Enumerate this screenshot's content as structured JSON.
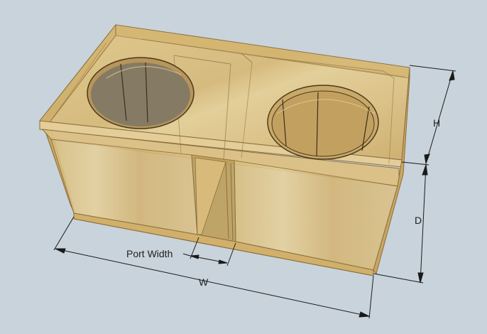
{
  "dimension_labels": {
    "height": "H",
    "depth": "D",
    "width": "W",
    "port_width": "Port Width"
  },
  "colors": {
    "background": "#c9d3db",
    "wood_top": "#dcc07f",
    "wood_side": "#cfae66",
    "wood_front": "#d6b872",
    "wood_dark_edge": "#8a6e3a",
    "wood_light_edge": "#e8d3a0",
    "dimension_line": "#1a1a1a"
  },
  "icons": [
    "woofer-cutout-left",
    "woofer-cutout-right"
  ]
}
